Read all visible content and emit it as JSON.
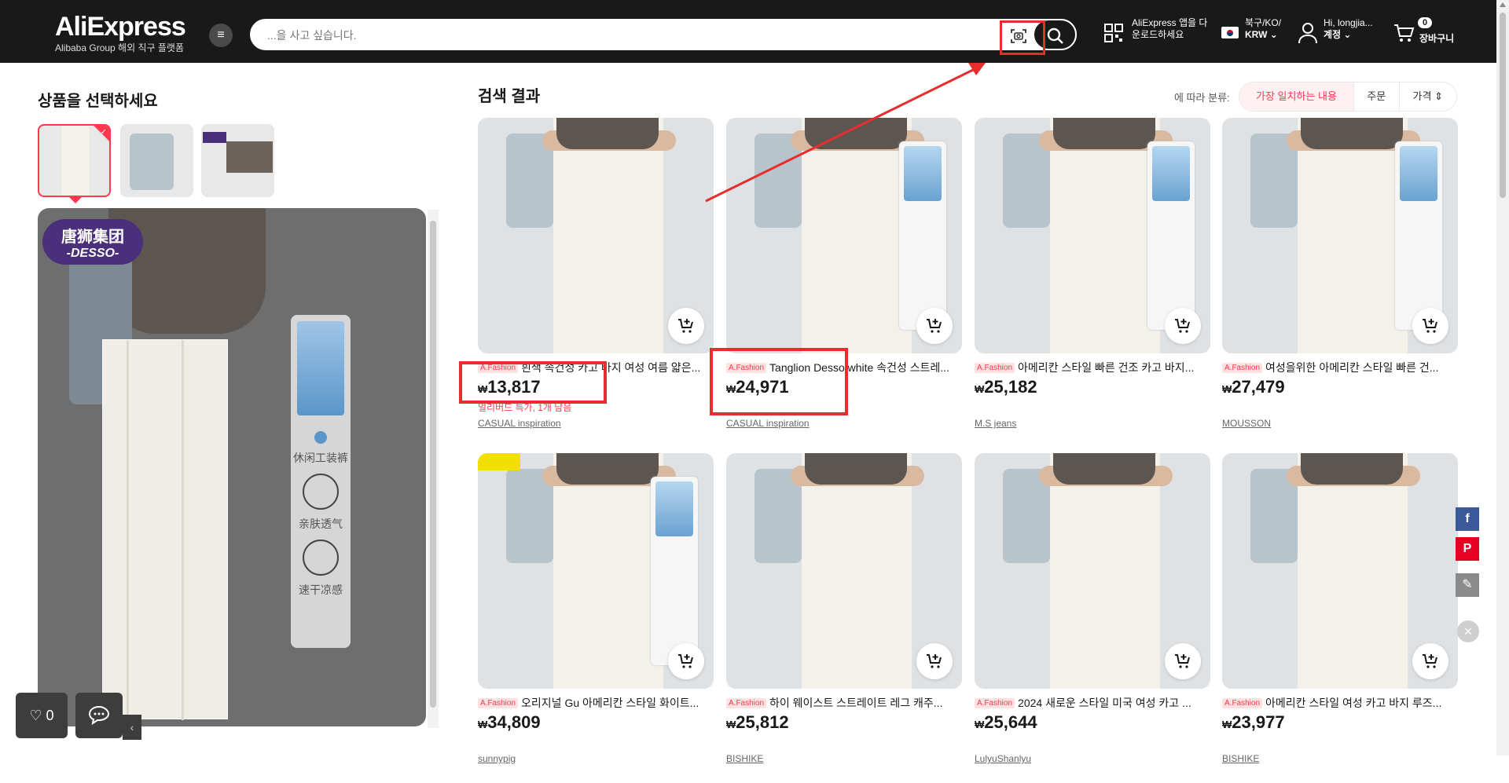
{
  "header": {
    "logo_main": "AliExpress",
    "logo_sub": "Alibaba Group 해외 직구 플랫폼",
    "search_placeholder": "...을 사고 싶습니다.",
    "app_line1": "AliExpress 앱을 다",
    "app_line2": "운로드하세요",
    "region_line1": "북구/KO/",
    "region_line2": "KRW ⌄",
    "user_line1": "Hi, longjia...",
    "user_line2": "계정 ⌄",
    "cart_count": "0",
    "cart_label": "장바구니"
  },
  "left_panel": {
    "title": "상품을 선택하세요",
    "brand_zh": "唐狮集团",
    "brand_en": "-DESSO-",
    "tag_text1": "休闲工装裤",
    "tag_text2": "亲肤透气",
    "tag_text3": "速干凉感",
    "favorites_count": "♡ 0"
  },
  "results": {
    "title": "검색 결과",
    "sort_label": "에 따라 분류:",
    "sort_options": [
      "가장 일치하는 내용",
      "주문",
      "가격 ⇕"
    ],
    "currency": "₩",
    "badge": "A.Fashion",
    "products": [
      {
        "title": "흰색 속건성 카고 바지 여성 여름 얇은...",
        "price": "13,817",
        "promo": "얼리버드 특가, 1개 남음",
        "store": "CASUAL inspiration"
      },
      {
        "title": "Tanglion Desso white 속건성 스트레...",
        "price": "24,971",
        "promo": "",
        "store": "CASUAL inspiration"
      },
      {
        "title": "아메리칸 스타일 빠른 건조 카고 바지...",
        "price": "25,182",
        "promo": "",
        "store": "M.S jeans"
      },
      {
        "title": "여성을위한 아메리칸 스타일 빠른 건...",
        "price": "27,479",
        "promo": "",
        "store": "MOUSSON"
      },
      {
        "title": "오리지널 Gu 아메리칸 스타일 화이트...",
        "price": "34,809",
        "promo": "",
        "store": "sunnypig"
      },
      {
        "title": "하이 웨이스트 스트레이트 레그 캐주...",
        "price": "25,812",
        "promo": "",
        "store": "BISHIKE"
      },
      {
        "title": "2024 새로운 스타일 미국 여성 카고 ...",
        "price": "25,644",
        "promo": "",
        "store": "LulyuShanlyu"
      },
      {
        "title": "아메리칸 스타일 여성 카고 바지 루즈...",
        "price": "23,977",
        "promo": "",
        "store": "BISHIKE"
      }
    ]
  },
  "side_social": [
    "f",
    "P",
    "✎"
  ]
}
